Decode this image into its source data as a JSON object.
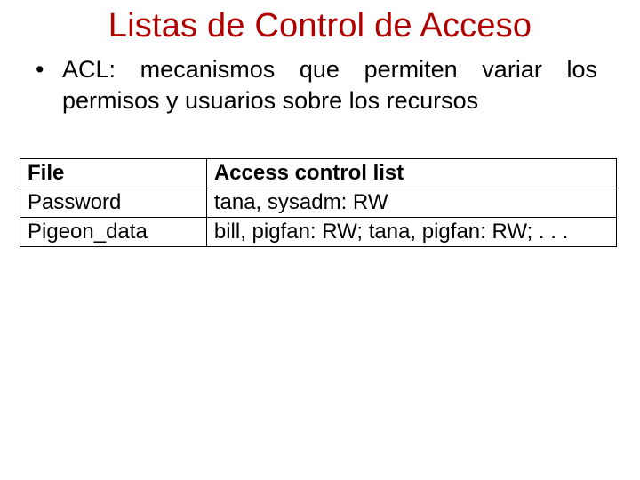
{
  "title": "Listas de Control de Acceso",
  "bullet": {
    "marker": "•",
    "text": "ACL: mecanismos que permiten variar los permisos y usuarios sobre los recursos"
  },
  "table": {
    "headers": {
      "file": "File",
      "acl": "Access control list"
    },
    "rows": [
      {
        "file": "Password",
        "acl": "tana, sysadm: RW"
      },
      {
        "file": "Pigeon_data",
        "acl": "bill, pigfan: RW;  tana, pigfan: RW; . . ."
      }
    ]
  }
}
